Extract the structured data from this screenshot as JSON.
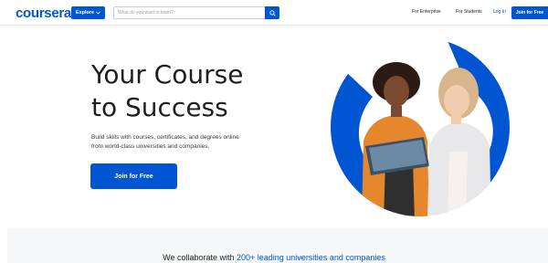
{
  "header": {
    "logo": "coursera",
    "explore_label": "Explore",
    "search_placeholder": "What do you want to learn?",
    "links": {
      "enterprise": "For Enterprise",
      "students": "For Students",
      "login": "Log In"
    },
    "join_label": "Join for Free"
  },
  "hero": {
    "title_line1": "Your Course",
    "title_line2": "to Success",
    "subtitle_line1": "Build skills with courses, certificates, and degrees online",
    "subtitle_line2": "from world-class universities and companies.",
    "join_label": "Join for Free"
  },
  "partners": {
    "prefix": "We collaborate with ",
    "highlight": "200+ leading universities and companies"
  },
  "colors": {
    "brand": "#0056d2",
    "text": "#1f1f1f",
    "band": "#f5f7f8"
  },
  "icons": {
    "search": "search-icon",
    "chevron": "chevron-down-icon"
  }
}
